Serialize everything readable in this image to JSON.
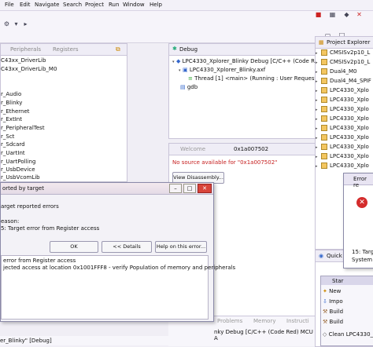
{
  "menu": [
    "File",
    "Edit",
    "Navigate",
    "Search",
    "Project",
    "Run",
    "Window",
    "Help"
  ],
  "peripherals": {
    "tab": "Peripherals",
    "tab2": "Registers"
  },
  "left_tree": [
    "C43xx_DriverLib",
    "C43xx_DriverLib_M0",
    "r_Audio",
    "r_Blinky",
    "r_Ethernet",
    "r_ExtInt",
    "r_PeripheralTest",
    "r_Sct",
    "r_Sdcard",
    "r_UartInt",
    "r_UartPolling",
    "r_UsbDevice",
    "r_UsbVcomLib"
  ],
  "debug": {
    "tab": "Debug",
    "items": [
      "LPC4330_Xplorer_Blinky Debug [C/C++ (Code Red)]",
      "LPC4330_Xplorer_Blinky.axf",
      "Thread [1] <main> (Running : User Request)",
      "gdb"
    ]
  },
  "editor": {
    "tab_welcome": "Welcome",
    "tab_addr": "0x1a007502",
    "no_source": "No source available for \"0x1a007502\"",
    "disasm_button": "View Disassembly..."
  },
  "dialog": {
    "title": "orted by target",
    "line1": "arget reported errors",
    "line2": "eason:",
    "line3": "5: Target error from Register access",
    "ok": "OK",
    "details": "<< Details",
    "help": "Help on this error...",
    "detail1": "error from Register access",
    "detail2": "jected access at location 0x1001FFF8 - verify Population of memory and peripherals"
  },
  "bottom": {
    "tabs": [
      "Problems",
      "Memory",
      "Instructi"
    ],
    "status": "nky Debug [C/C++ (Code Red) MCU A",
    "status2": "er_Blinky\" [Debug]"
  },
  "project": {
    "tab": "Project Explorer",
    "items": [
      "CMSISv2p10_L",
      "CMSISv2p10_L",
      "Dual4_M0",
      "Dual4_M4_SPIF",
      "LPC4330_Xplo",
      "LPC4330_Xplo",
      "LPC4330_Xplo",
      "LPC4330_Xplo",
      "LPC4330_Xplo",
      "LPC4330_Xplo",
      "LPC4330_Xplo",
      "LPC4330_Xplo",
      "LPC4330_Xplo"
    ]
  },
  "error_dialog": {
    "title": "Error re",
    "line1": "15: Targ",
    "line2": "System e"
  },
  "quickstart": {
    "tab": "Quick",
    "header": "Star",
    "items": [
      "New",
      "Impo",
      "Build",
      "Build",
      "Clean"
    ],
    "clean_suffix": "LPC4330_Xp"
  }
}
